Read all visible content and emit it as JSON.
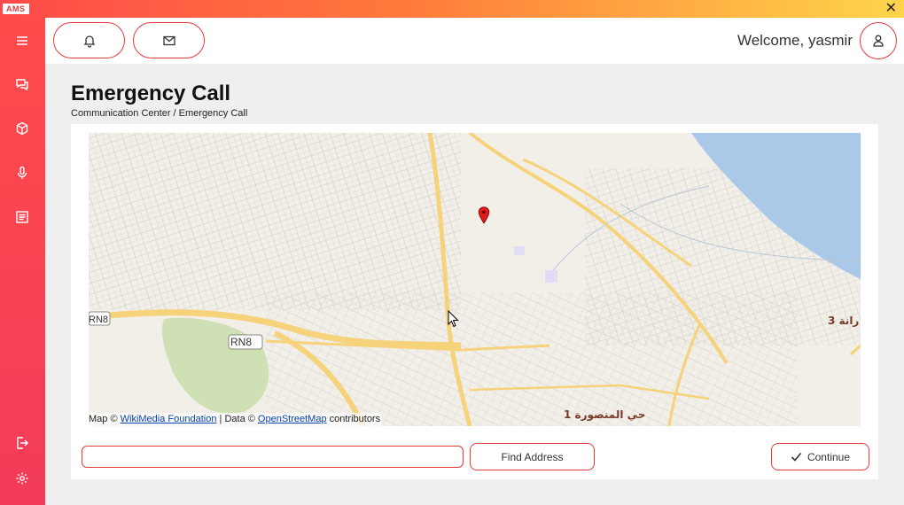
{
  "app": {
    "logo_text": "AMS",
    "close_glyph": "✕"
  },
  "sidebar": {
    "items": [
      {
        "icon": "menu-icon"
      },
      {
        "icon": "chat-icon"
      },
      {
        "icon": "cube-icon"
      },
      {
        "icon": "microphone-icon"
      },
      {
        "icon": "document-icon"
      },
      {
        "icon": "logout-icon"
      },
      {
        "icon": "gear-icon"
      }
    ],
    "gradient": [
      "#ff4b49",
      "#f23b5a"
    ]
  },
  "header": {
    "welcome_text": "Welcome, yasmir",
    "notification_icon": "bell-icon",
    "messages_icon": "envelope-icon",
    "profile_icon": "user-icon"
  },
  "page": {
    "title": "Emergency Call",
    "breadcrumb": "Communication Center / Emergency Call"
  },
  "map": {
    "attribution_prefix": "Map ©",
    "attribution_link1": "WikiMedia Foundation",
    "attribution_middle": "| Data ©",
    "attribution_link2": "OpenStreetMap",
    "attribution_suffix": "contributors",
    "road_label_1": "RN8",
    "road_label_2": "RN8",
    "place_label_1": "حي المنصورة 1",
    "place_label_2": "3 رانة",
    "marker_color": "#e01b1b",
    "water_color": "#aac8e8",
    "road_color": "#f6d27a",
    "park_color": "#cfe0b4"
  },
  "form": {
    "address_value": "",
    "find_button_label": "Find Address",
    "continue_button_label": "Continue"
  },
  "colors": {
    "accent": "#e23b3b"
  }
}
